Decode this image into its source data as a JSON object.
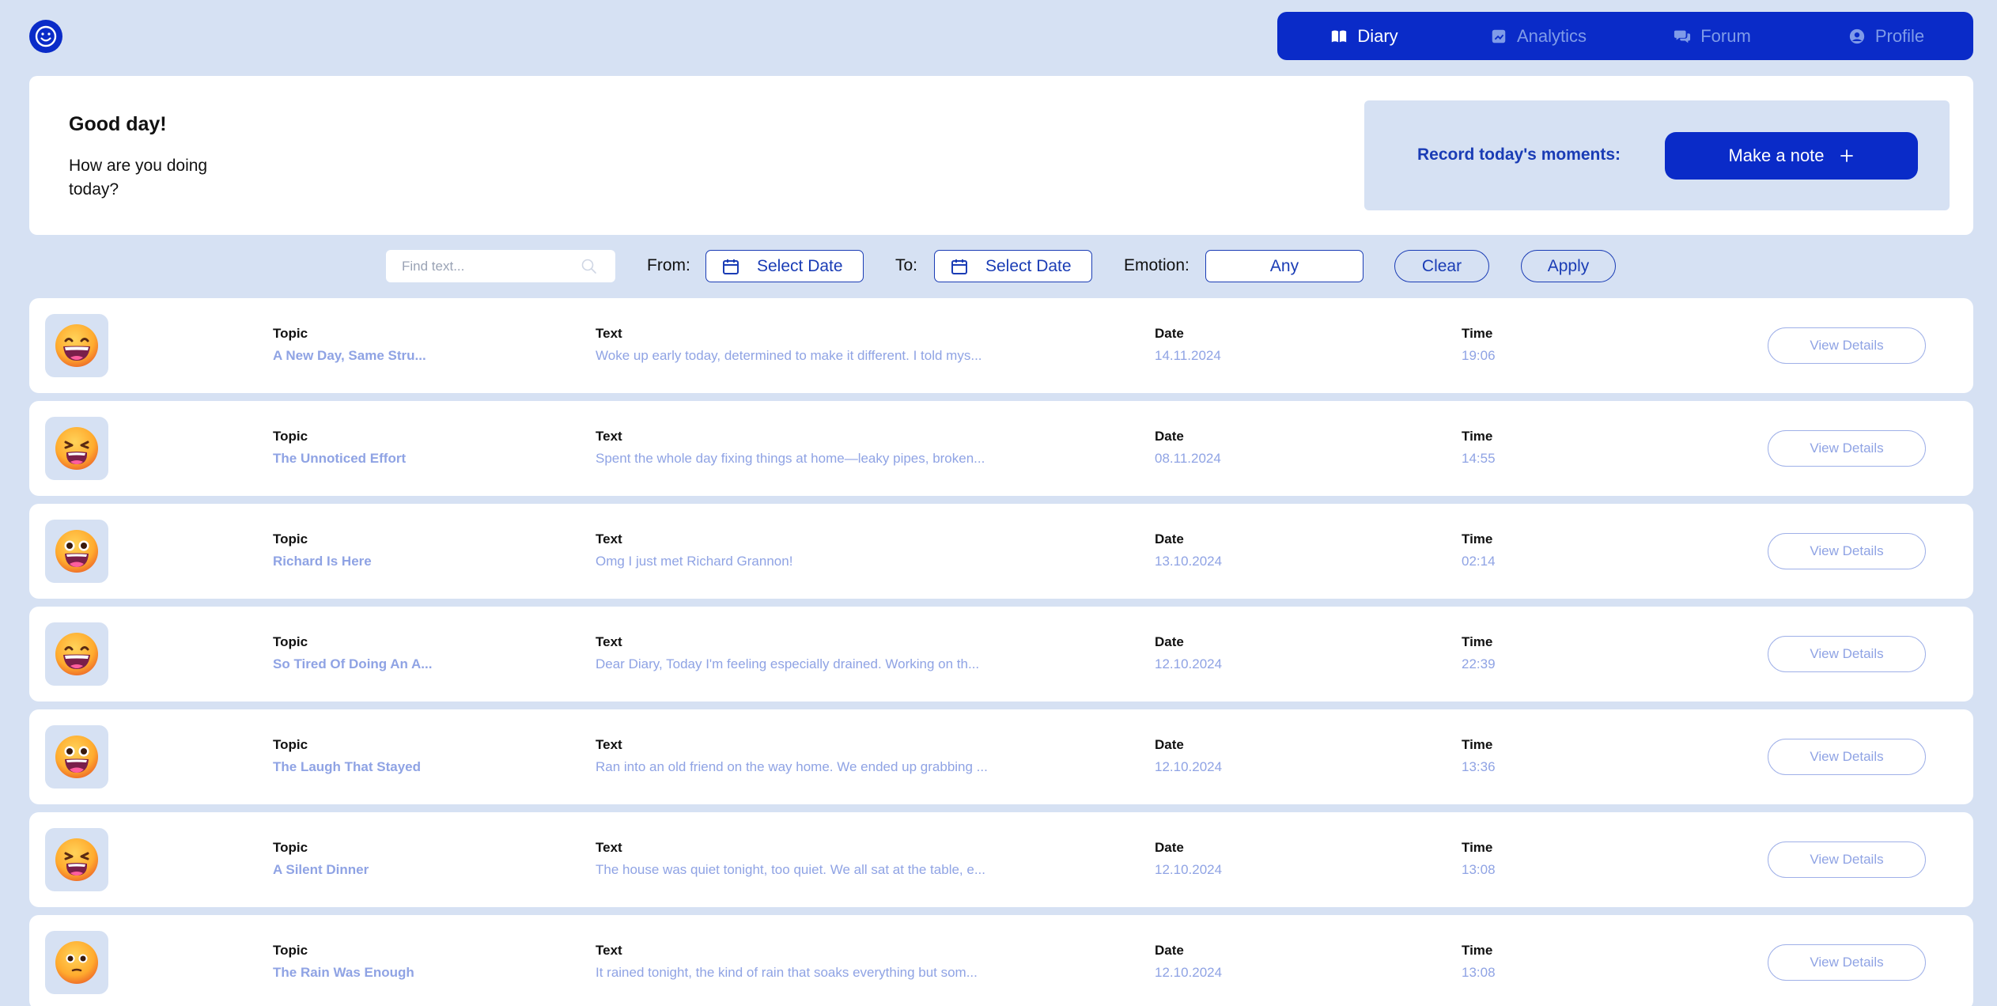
{
  "nav": {
    "items": [
      {
        "label": "Diary",
        "icon": "book-icon",
        "active": true
      },
      {
        "label": "Analytics",
        "icon": "chart-icon",
        "active": false
      },
      {
        "label": "Forum",
        "icon": "chat-icon",
        "active": false
      },
      {
        "label": "Profile",
        "icon": "user-icon",
        "active": false
      }
    ]
  },
  "greeting": {
    "title": "Good day!",
    "subtitle": "How are you doing today?",
    "record_label": "Record today's moments:",
    "make_note_label": "Make a note"
  },
  "filters": {
    "search_placeholder": "Find text...",
    "from_label": "From:",
    "from_value": "Select Date",
    "to_label": "To:",
    "to_value": "Select Date",
    "emotion_label": "Emotion:",
    "emotion_value": "Any",
    "clear_label": "Clear",
    "apply_label": "Apply"
  },
  "columns": {
    "topic": "Topic",
    "text": "Text",
    "date": "Date",
    "time": "Time"
  },
  "view_details_label": "View Details",
  "entries": [
    {
      "emoji": "grin",
      "topic": "A New Day, Same Stru...",
      "text": "Woke up early today, determined to make it different. I told mys...",
      "date": "14.11.2024",
      "time": "19:06"
    },
    {
      "emoji": "tired",
      "topic": "The Unnoticed Effort",
      "text": "Spent the whole day fixing things at home—leaky pipes, broken...",
      "date": "08.11.2024",
      "time": "14:55"
    },
    {
      "emoji": "excited",
      "topic": "Richard Is Here",
      "text": "Omg I just met Richard Grannon!",
      "date": "13.10.2024",
      "time": "02:14"
    },
    {
      "emoji": "grin",
      "topic": "So Tired Of Doing An A...",
      "text": "Dear Diary, Today I'm feeling especially drained. Working on th...",
      "date": "12.10.2024",
      "time": "22:39"
    },
    {
      "emoji": "excited",
      "topic": "The Laugh That Stayed",
      "text": "Ran into an old friend on the way home. We ended up grabbing ...",
      "date": "12.10.2024",
      "time": "13:36"
    },
    {
      "emoji": "tired",
      "topic": "A Silent Dinner",
      "text": "The house was quiet tonight, too quiet. We all sat at the table, e...",
      "date": "12.10.2024",
      "time": "13:08"
    },
    {
      "emoji": "neutral",
      "topic": "The Rain Was Enough",
      "text": "It rained tonight, the kind of rain that soaks everything but som...",
      "date": "12.10.2024",
      "time": "13:08"
    }
  ]
}
